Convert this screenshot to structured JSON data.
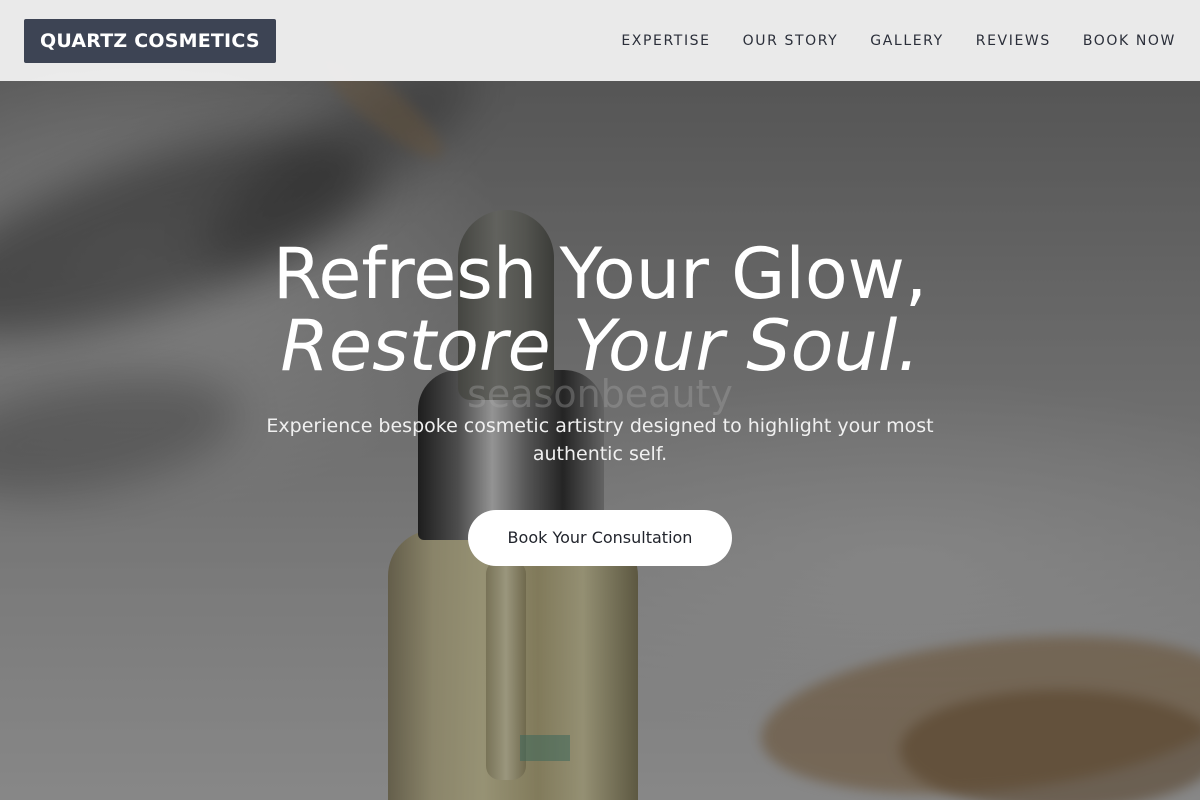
{
  "brand": {
    "name": "QUARTZ COSMETICS"
  },
  "nav": {
    "items": [
      {
        "label": "EXPERTISE"
      },
      {
        "label": "OUR STORY"
      },
      {
        "label": "GALLERY"
      },
      {
        "label": "REVIEWS"
      },
      {
        "label": "BOOK NOW"
      }
    ]
  },
  "hero": {
    "headline_line1": "Refresh Your Glow,",
    "headline_line2": "Restore Your Soul.",
    "subtitle": "Experience bespoke cosmetic artistry designed to highlight your most authentic self.",
    "cta_label": "Book Your Consultation",
    "background_watermark": "seasonbeauty"
  },
  "colors": {
    "brand_bg": "#3d4454",
    "nav_bg": "#f0f0f0",
    "nav_text": "#2b2f3a",
    "cta_bg": "#ffffff",
    "cta_text": "#22252d"
  }
}
